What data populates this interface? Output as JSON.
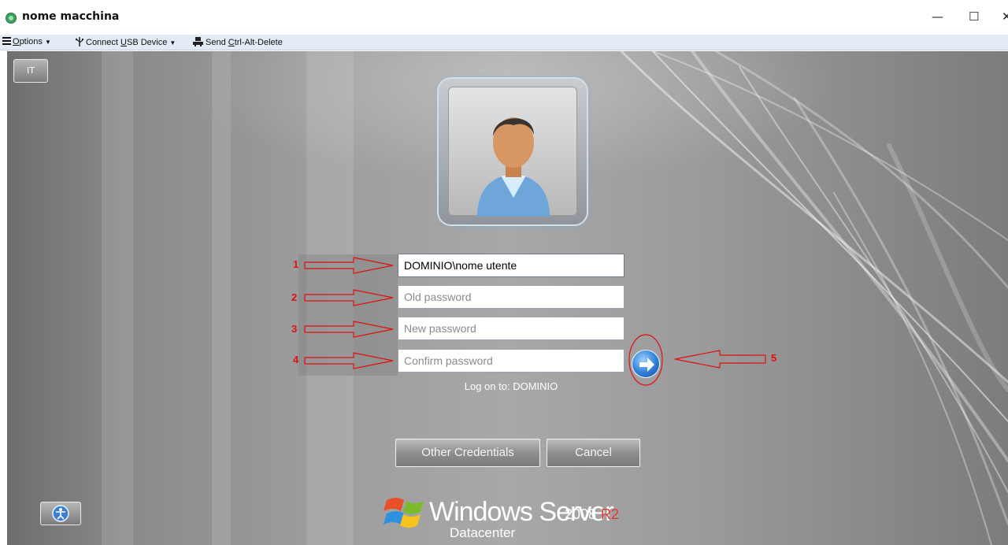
{
  "window": {
    "title": "nome macchina",
    "minimize_glyph": "—",
    "maximize_glyph": "☐",
    "close_glyph": "✕"
  },
  "toolbar": {
    "options_prefix": "",
    "options_hotkey": "O",
    "options_rest": "ptions",
    "usb_prefix": "Connect ",
    "usb_hotkey": "U",
    "usb_rest": "SB Device",
    "cad_prefix": "Send ",
    "cad_hotkey": "C",
    "cad_rest": "trl-Alt-Delete"
  },
  "login": {
    "language_label": "IT",
    "username_value": "DOMINIO\\nome utente",
    "old_password_placeholder": "Old password",
    "new_password_placeholder": "New password",
    "confirm_password_placeholder": "Confirm password",
    "logon_to": "Log on to: DOMINIO",
    "other_credentials_label": "Other Credentials",
    "cancel_label": "Cancel"
  },
  "branding": {
    "product": "Windows Server",
    "year": "2008",
    "release": "R2",
    "edition": "Datacenter"
  },
  "annotations": {
    "color": "#e01010",
    "labels": [
      "1",
      "2",
      "3",
      "4",
      "5"
    ]
  },
  "icons": {
    "app": "green-circle-icon",
    "options": "hamburger-menu-icon",
    "usb": "usb-icon",
    "cad": "keyboard-network-icon",
    "submit": "arrow-right-icon",
    "accessibility": "ease-of-access-icon",
    "logo": "windows-flag-icon"
  }
}
